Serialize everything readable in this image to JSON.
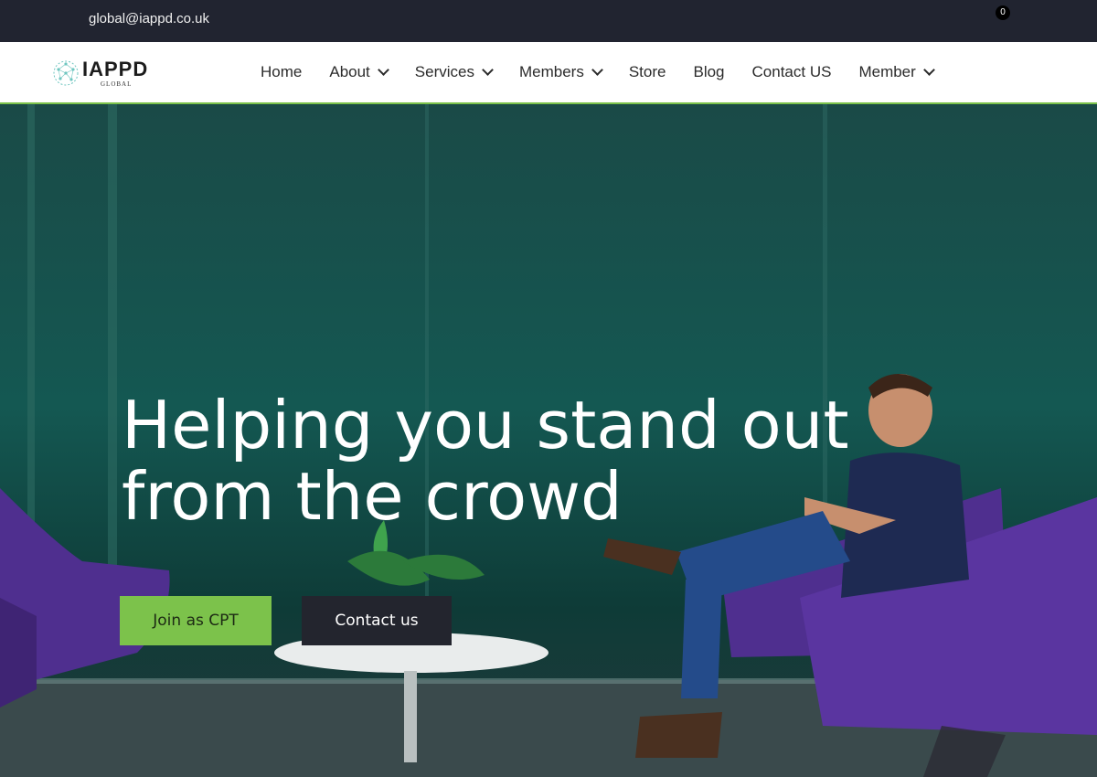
{
  "topbar": {
    "email": "global@iappd.co.uk",
    "cart_count": "0"
  },
  "logo": {
    "word": "IAPPD",
    "sub": "GLOBAL"
  },
  "nav": {
    "items": [
      {
        "label": "Home",
        "dropdown": false
      },
      {
        "label": "About",
        "dropdown": true
      },
      {
        "label": "Services",
        "dropdown": true
      },
      {
        "label": "Members",
        "dropdown": true
      },
      {
        "label": "Store",
        "dropdown": false
      },
      {
        "label": "Blog",
        "dropdown": false
      },
      {
        "label": "Contact US",
        "dropdown": false
      },
      {
        "label": "Member",
        "dropdown": true
      }
    ]
  },
  "hero": {
    "line1": "Helping you stand out",
    "line2": "from the crowd",
    "join_label": "Join as CPT",
    "contact_label": "Contact us"
  },
  "colors": {
    "accent": "#7cc24b",
    "dark": "#212430",
    "chair": "#4f2f8f"
  }
}
